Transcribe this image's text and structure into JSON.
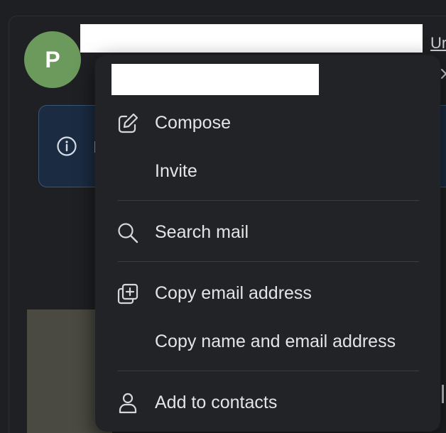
{
  "sender": {
    "avatar_initial": "P",
    "unsubscribe_label": "Ur"
  },
  "context_menu": {
    "items": [
      {
        "label": "Compose",
        "icon": "compose-icon"
      },
      {
        "label": "Invite",
        "icon": ""
      },
      {
        "label": "Search mail",
        "icon": "search-icon"
      },
      {
        "label": "Copy email address",
        "icon": "copy-icon"
      },
      {
        "label": "Copy name and email address",
        "icon": ""
      },
      {
        "label": "Add to contacts",
        "icon": "person-icon"
      }
    ]
  },
  "colors": {
    "page_background": "#1e1f22",
    "menu_background": "#222326",
    "menu_text": "#e3e4e6",
    "avatar": "#6c9a5c",
    "info_banner": "#1b2c42"
  }
}
